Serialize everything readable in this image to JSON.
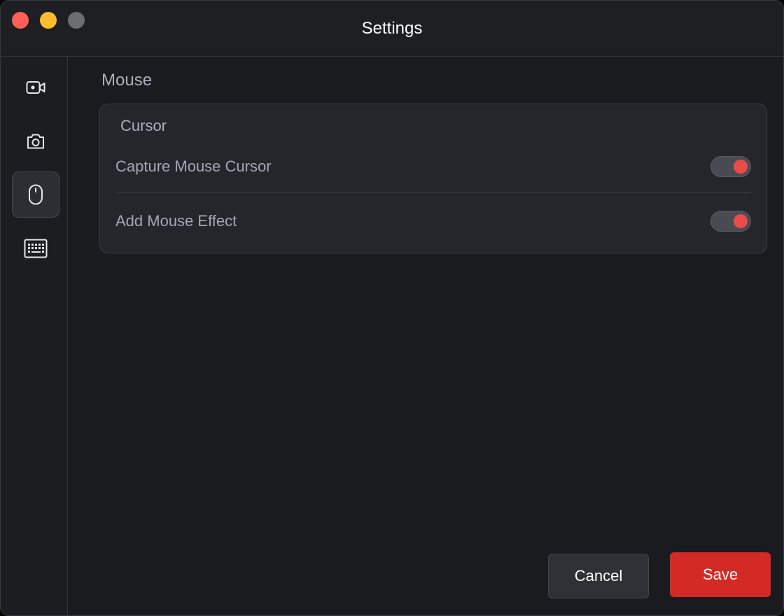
{
  "window": {
    "title": "Settings"
  },
  "colors": {
    "close": "#ff5f57",
    "minimize": "#febc2e",
    "maximize": "#6e6e72",
    "accent": "#d32a26",
    "toggle_knob": "#e94b49",
    "icon": "#e6e7ea"
  },
  "sidebar": {
    "items": [
      {
        "icon": "video-camera-icon",
        "active": false
      },
      {
        "icon": "camera-icon",
        "active": false
      },
      {
        "icon": "mouse-icon",
        "active": true
      },
      {
        "icon": "keyboard-icon",
        "active": false
      }
    ]
  },
  "main": {
    "section_title": "Mouse",
    "panel": {
      "title": "Cursor",
      "rows": [
        {
          "label": "Capture Mouse Cursor",
          "enabled": true
        },
        {
          "label": "Add Mouse Effect",
          "enabled": true
        }
      ]
    }
  },
  "footer": {
    "cancel_label": "Cancel",
    "save_label": "Save"
  }
}
